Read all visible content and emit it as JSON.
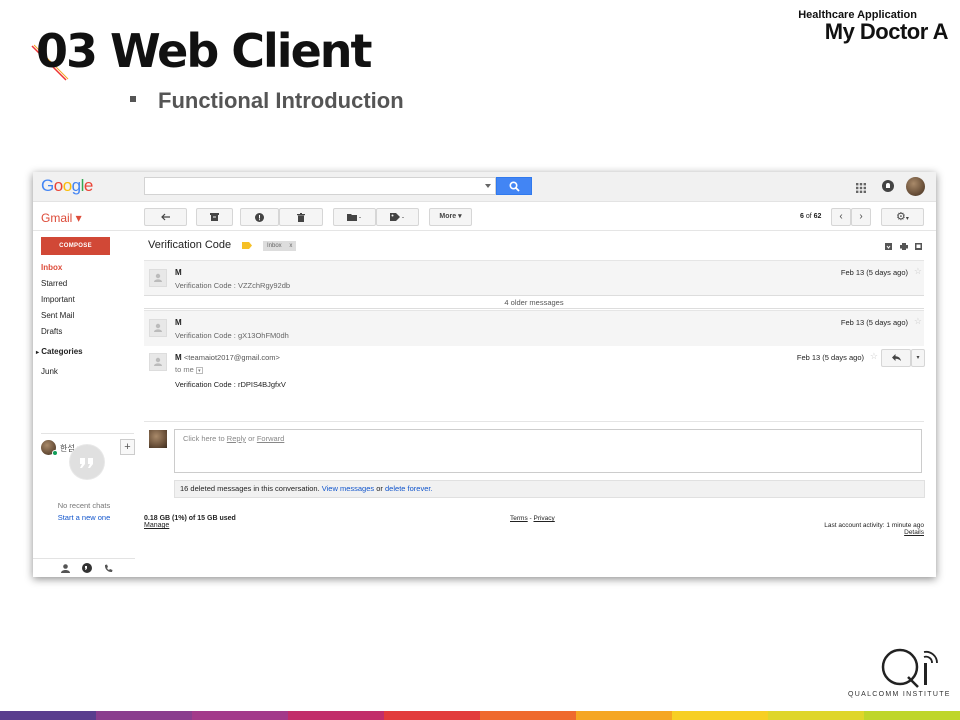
{
  "slide": {
    "title": "03 Web Client",
    "header_small": "Healthcare Application",
    "header_big": "My Doctor A",
    "bullet": "Functional Introduction",
    "footer_brand": "QUALCOMM INSTITUTE",
    "stripe_colors": [
      "#5a3e8e",
      "#8a3e8e",
      "#a33a8a",
      "#c22e6a",
      "#e23b3b",
      "#ef6a2e",
      "#f5a623",
      "#f7cf23",
      "#dfd62a",
      "#bfd62a"
    ]
  },
  "gmail": {
    "logo": [
      "G",
      "o",
      "o",
      "g",
      "l",
      "e"
    ],
    "logo_colors": [
      "#4285f4",
      "#ea4335",
      "#fbbc05",
      "#4285f4",
      "#34a853",
      "#ea4335"
    ],
    "search": {
      "value": "",
      "placeholder": ""
    },
    "app_label": "Gmail ▾",
    "toolbar": {
      "more_label": "More ▾"
    },
    "pager": {
      "current": "6",
      "of": "of",
      "total": "62"
    },
    "compose_label": "COMPOSE",
    "nav": [
      {
        "label": "Inbox",
        "active": true
      },
      {
        "label": "Starred"
      },
      {
        "label": "Important"
      },
      {
        "label": "Sent Mail"
      },
      {
        "label": "Drafts"
      },
      {
        "label": "Categories",
        "bold": true,
        "expandable": true
      },
      {
        "label": "Junk"
      }
    ],
    "hangout_user": "한섭 ▾",
    "hangout_add": "+",
    "no_chats": "No recent chats",
    "start_new": "Start a new one",
    "thread": {
      "subject": "Verification Code",
      "label": "Inbox",
      "label_close": "x",
      "messages": [
        {
          "from": "M",
          "snippet": "Verification Code : VZZchRgy92db",
          "date": "Feb 13 (5 days ago)"
        },
        {
          "from": "M",
          "snippet": "Verification Code : gX13OhFM0dh",
          "date": "Feb 13 (5 days ago)"
        }
      ],
      "older_messages": "4 older messages",
      "expanded": {
        "from": "M",
        "email": "<teamaiot2017@gmail.com>",
        "to": "to me",
        "body": "Verification Code : rDPIS4BJgfxV",
        "date": "Feb 13 (5 days ago)"
      },
      "reply_prefix": "Click here to",
      "reply_link": "Reply",
      "reply_or": "or",
      "forward_link": "Forward",
      "deleted_text": "16 deleted messages in this conversation.",
      "view_link": "View messages",
      "deleted_or": "or",
      "delete_link": "delete forever."
    },
    "footer": {
      "storage": "0.18 GB (1%) of 15 GB used",
      "manage": "Manage",
      "terms": "Terms",
      "sep": " - ",
      "privacy": "Privacy",
      "activity": "Last account activity: 1 minute ago",
      "details": "Details"
    }
  }
}
